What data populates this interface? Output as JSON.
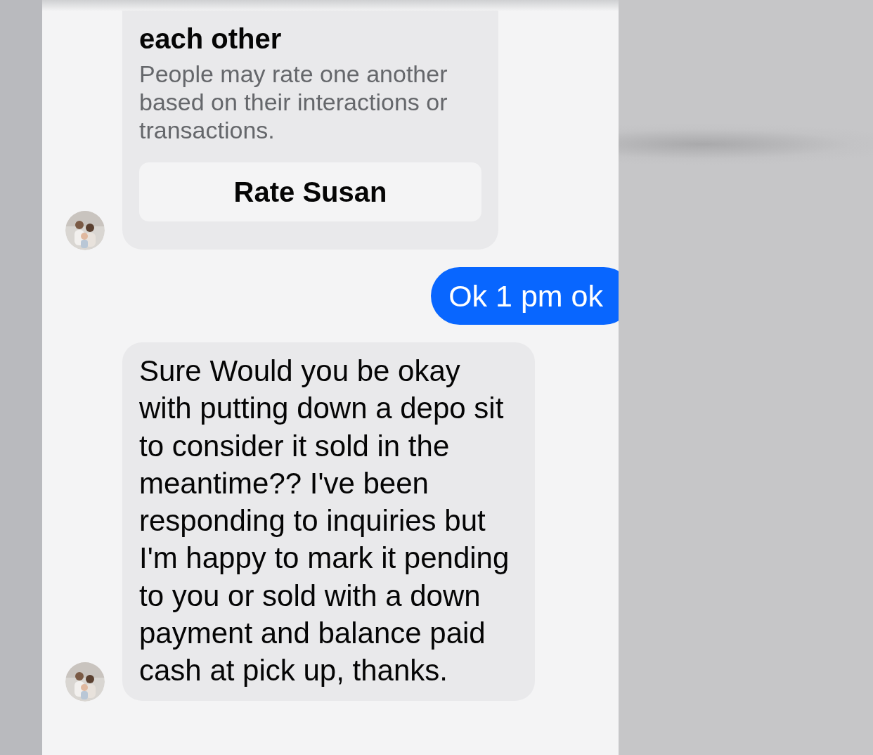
{
  "messages": [
    {
      "kind": "rating_card",
      "title": "each other",
      "description": "People may rate one another based on their interactions or transactions.",
      "button": "Rate Susan"
    },
    {
      "kind": "outgoing",
      "text": "Ok 1 pm ok"
    },
    {
      "kind": "incoming",
      "text": "Sure Would you be okay with putting down a depo sit to consider it sold in the meantime?? I've been responding to inquiries but I'm happy to mark it pending to you or sold with a down payment and balance paid cash at pick up, thanks."
    }
  ]
}
